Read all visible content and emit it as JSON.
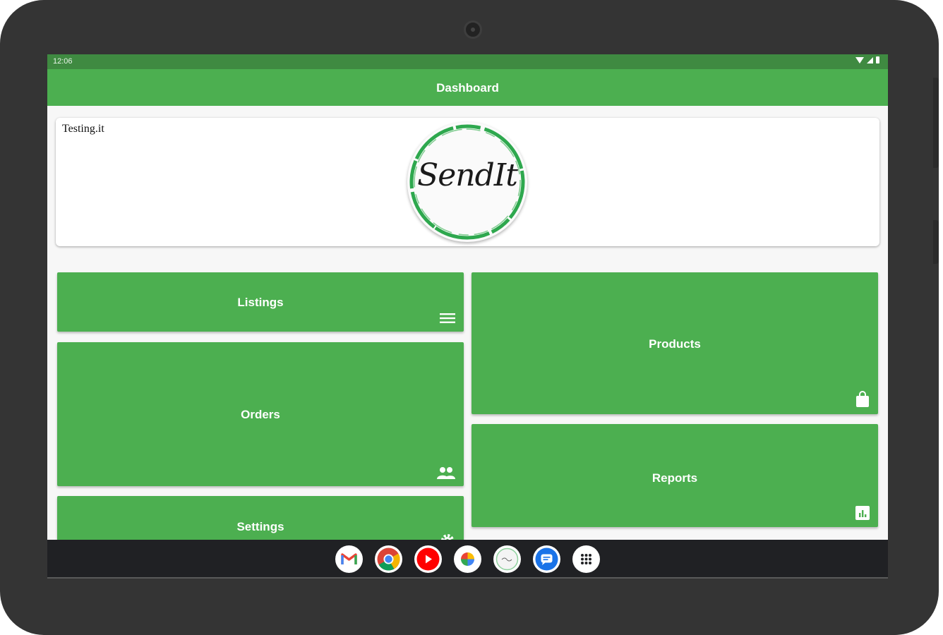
{
  "status_bar": {
    "time": "12:06"
  },
  "app_bar": {
    "title": "Dashboard"
  },
  "header": {
    "store_name": "Testing.it",
    "logo_text": "SendIt"
  },
  "tiles": {
    "listings": {
      "label": "Listings",
      "icon": "list-icon"
    },
    "orders": {
      "label": "Orders",
      "icon": "people-icon"
    },
    "settings": {
      "label": "Settings",
      "icon": "gear-icon"
    },
    "products": {
      "label": "Products",
      "icon": "shopping-bag-icon"
    },
    "reports": {
      "label": "Reports",
      "icon": "bar-chart-icon"
    }
  },
  "dock": [
    "gmail-icon",
    "chrome-icon",
    "youtube-icon",
    "photos-icon",
    "sendit-app-icon",
    "messages-icon",
    "app-drawer-icon"
  ],
  "colors": {
    "primary": "#4caf50",
    "status_bar": "#3f8a41",
    "nav_bar": "#202124",
    "bezel": "#343434"
  }
}
